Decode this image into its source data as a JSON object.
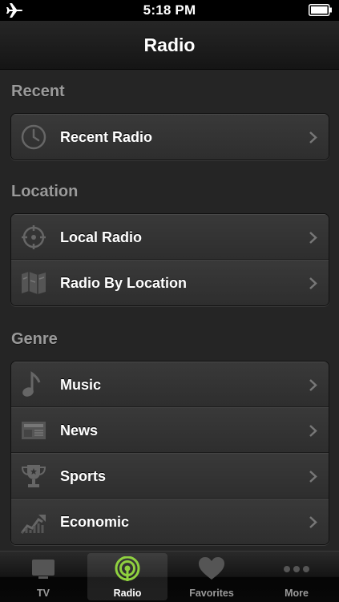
{
  "status_bar": {
    "time": "5:18 PM"
  },
  "nav": {
    "title": "Radio"
  },
  "sections": [
    {
      "header": "Recent",
      "items": [
        {
          "label": "Recent Radio",
          "icon": "clock-icon"
        }
      ]
    },
    {
      "header": "Location",
      "items": [
        {
          "label": "Local Radio",
          "icon": "location-crosshair-icon"
        },
        {
          "label": "Radio By Location",
          "icon": "map-icon"
        }
      ]
    },
    {
      "header": "Genre",
      "items": [
        {
          "label": "Music",
          "icon": "music-note-icon"
        },
        {
          "label": "News",
          "icon": "newspaper-icon"
        },
        {
          "label": "Sports",
          "icon": "trophy-icon"
        },
        {
          "label": "Economic",
          "icon": "chart-icon"
        }
      ]
    }
  ],
  "tabs": [
    {
      "label": "TV",
      "icon": "tv-icon",
      "active": false
    },
    {
      "label": "Radio",
      "icon": "radio-signal-icon",
      "active": true
    },
    {
      "label": "Favorites",
      "icon": "heart-icon",
      "active": false
    },
    {
      "label": "More",
      "icon": "more-dots-icon",
      "active": false
    }
  ],
  "colors": {
    "active_tab_icon": "#8fd13f",
    "background": "#252525",
    "section_header": "#9a9a9a"
  }
}
